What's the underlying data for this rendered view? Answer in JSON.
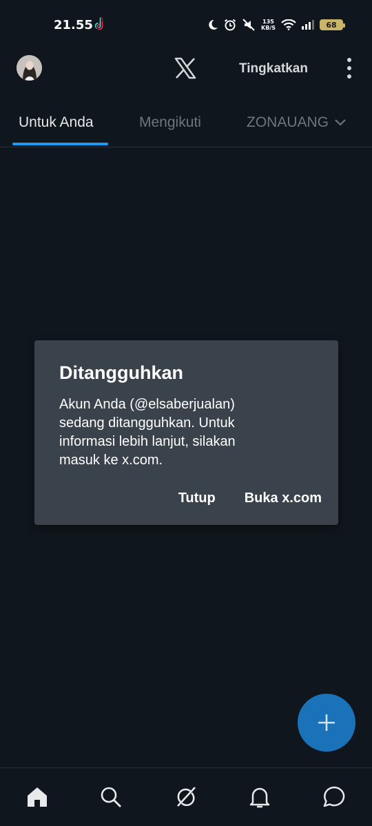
{
  "status_bar": {
    "time": "21.55",
    "net_speed_value": "135",
    "net_speed_unit": "KB/S",
    "battery_level": "68",
    "icons": [
      "tiktok-icon",
      "moon-icon",
      "alarm-icon",
      "mute-icon",
      "wifi-icon",
      "signal-icon",
      "battery-icon"
    ]
  },
  "header": {
    "logo": "x-logo-icon",
    "upgrade_label": "Tingkatkan",
    "more_icon": "more-vertical-icon"
  },
  "tabs": [
    {
      "label": "Untuk Anda",
      "active": true
    },
    {
      "label": "Mengikuti",
      "active": false
    },
    {
      "label": "ZONAUANG",
      "active": false,
      "has_dropdown": true
    }
  ],
  "dialog": {
    "title": "Ditangguhkan",
    "line1": "Akun Anda (@elsaberjualan)",
    "line2": "sedang ditangguhkan. Untuk",
    "line3": "informasi lebih lanjut, silakan",
    "line4": "masuk ke x.com.",
    "close_label": "Tutup",
    "open_label": "Buka x.com"
  },
  "fab": {
    "icon": "plus-icon"
  },
  "bottom_nav": {
    "items": [
      "home-icon",
      "search-icon",
      "grok-icon",
      "notifications-icon",
      "messages-icon"
    ]
  },
  "colors": {
    "background": "#10161d",
    "accent": "#1d9bf0",
    "dialog": "#3a434c",
    "fab": "#1a72b8"
  }
}
